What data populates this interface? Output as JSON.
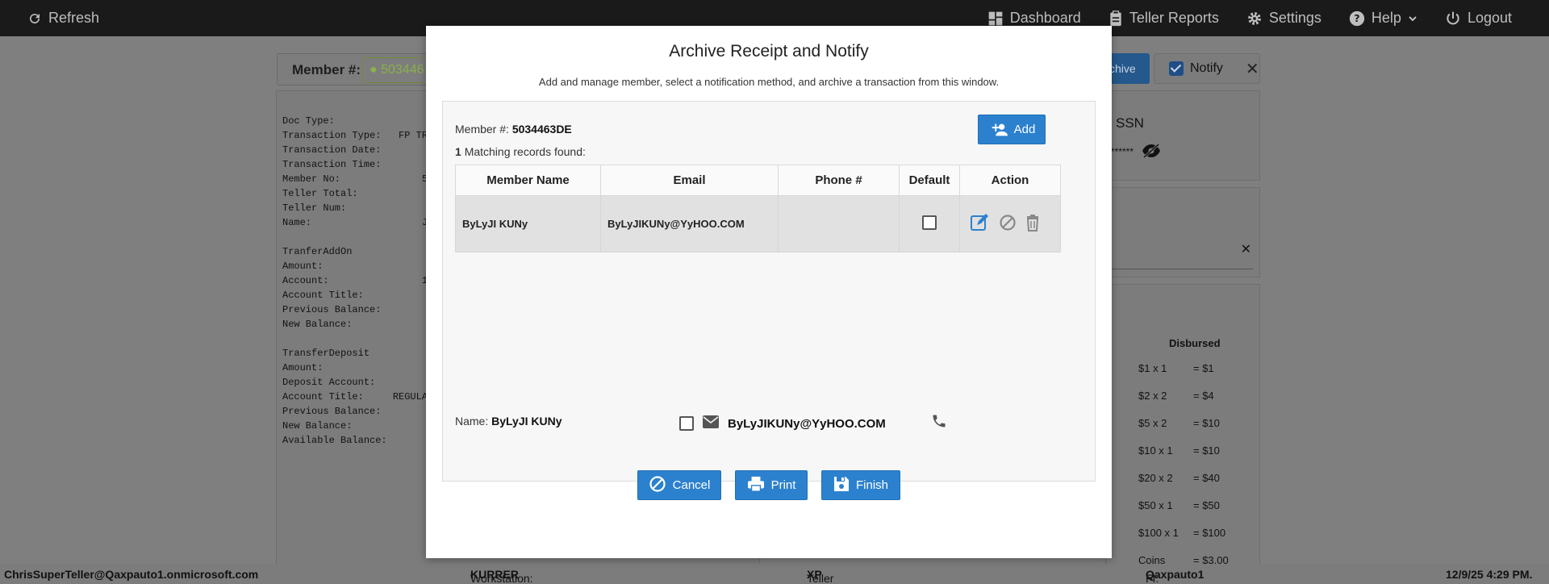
{
  "topbar": {
    "refresh": "Refresh",
    "nav": [
      "Dashboard",
      "Teller Reports",
      "Settings",
      "Help",
      "Logout"
    ]
  },
  "background": {
    "member_label": "Member #:",
    "member_value": "503446",
    "archive_chip": "chive",
    "notify_label": "Notify",
    "ssn_label": "SSN",
    "ssn_masked": "******",
    "receipt_lines": "Doc Type:\nTransaction Type:   FP TRA\nTransaction Date:\nTransaction Time:\nMember No:              5\nTeller Total:\nTeller Num:\nName:                   Ja\n\nTranferAddOn\nAmount:\nAccount:                1\nAccount Title:\nPrevious Balance:\nNew Balance:\n\nTransferDeposit\nAmount:\nDeposit Account:\nAccount Title:     REGULAR\nPrevious Balance:        *\nNew Balance:             *\nAvailable Balance:",
    "disbursed_header": "Disbursed",
    "disbursed_rows": [
      {
        "denom": "$1 x 1",
        "total": "= $1"
      },
      {
        "denom": "$2 x 2",
        "total": "= $4"
      },
      {
        "denom": "$5 x 2",
        "total": "= $10"
      },
      {
        "denom": "$10 x 1",
        "total": "= $10"
      },
      {
        "denom": "$20 x 2",
        "total": "= $40"
      },
      {
        "denom": "$50 x 1",
        "total": "= $50"
      },
      {
        "denom": "$100 x 1",
        "total": "= $100"
      },
      {
        "denom": "Coins",
        "total": "= $3.00"
      }
    ]
  },
  "modal": {
    "title": "Archive Receipt and Notify",
    "subtitle": "Add and manage member, select a notification method, and archive a transaction from this window.",
    "member_label": "Member #:",
    "member_number": "5034463DE",
    "matching_count": "1",
    "matching_text": "Matching records found:",
    "add_label": "Add",
    "columns": [
      "Member Name",
      "Email",
      "Phone #",
      "Default",
      "Action"
    ],
    "rows": [
      {
        "name": "ByLyJI KUNy",
        "email": "ByLyJIKUNy@YyHOO.COM",
        "phone": ""
      }
    ],
    "name_label": "Name:",
    "name_value": "ByLyJI KUNy",
    "notify_email": "ByLyJIKUNy@YyHOO.COM",
    "cancel_label": "Cancel",
    "print_label": "Print",
    "finish_label": "Finish"
  },
  "statusbar": {
    "user": "ChrisSuperTeller@Qaxpauto1.onmicrosoft.com",
    "workstation_label": "Workstation:",
    "workstation": "KURRER",
    "platform_label": "Teller Platform:",
    "platform": "XP",
    "fi_label": "FI:",
    "fi": "Qaxpauto1",
    "datetime": "12/9/25 4:29 PM."
  },
  "colors": {
    "accent": "#2c81ce",
    "topbar": "#1a1a1a",
    "overlay": "#7f7f7f"
  }
}
